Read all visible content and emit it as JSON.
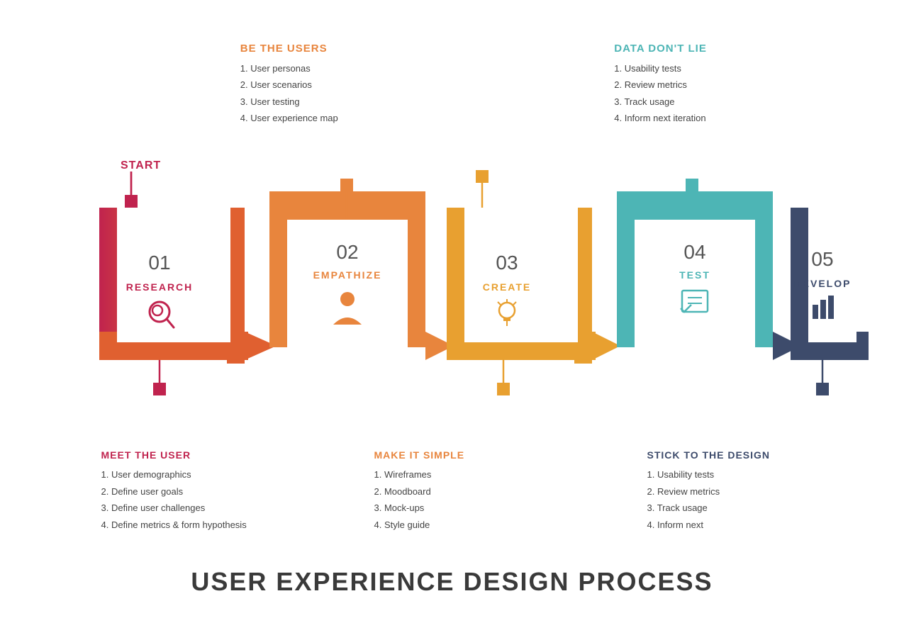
{
  "top_labels": [
    {
      "id": "be-the-users",
      "title": "BE THE USERS",
      "color": "orange",
      "items": [
        "1. User personas",
        "2. User scenarios",
        "3. User testing",
        "4. User experience map"
      ]
    },
    {
      "id": "data-dont-lie",
      "title": "DATA DON'T LIE",
      "color": "teal",
      "items": [
        "1. Usability tests",
        "2. Review metrics",
        "3. Track usage",
        "4. Inform next iteration"
      ]
    }
  ],
  "bottom_labels": [
    {
      "id": "meet-the-user",
      "title": "MEET THE USER",
      "color": "pink",
      "items": [
        "1. User demographics",
        "2. Define user goals",
        "3. Define user challenges",
        "4. Define metrics & form hypothesis"
      ]
    },
    {
      "id": "make-it-simple",
      "title": "MAKE  IT SIMPLE",
      "color": "orange",
      "items": [
        "1. Wireframes",
        "2. Moodboard",
        "3. Mock-ups",
        "4. Style guide"
      ]
    },
    {
      "id": "stick-to-design",
      "title": "STICK TO THE DESIGN",
      "color": "dark",
      "items": [
        "1. Usability tests",
        "2. Review metrics",
        "3. Track usage",
        "4. Inform next"
      ]
    }
  ],
  "steps": [
    {
      "num": "01",
      "label": "RESEARCH",
      "color": "#c0234e"
    },
    {
      "num": "02",
      "label": "EMPATHIZE",
      "color": "#e8853d"
    },
    {
      "num": "03",
      "label": "CREATE",
      "color": "#e8a030"
    },
    {
      "num": "04",
      "label": "TEST",
      "color": "#4db5b5"
    },
    {
      "num": "05",
      "label": "DEVELOP",
      "color": "#3d4b6b"
    }
  ],
  "start_label": "START",
  "footer_title": "USER EXPERIENCE DESIGN PROCESS"
}
